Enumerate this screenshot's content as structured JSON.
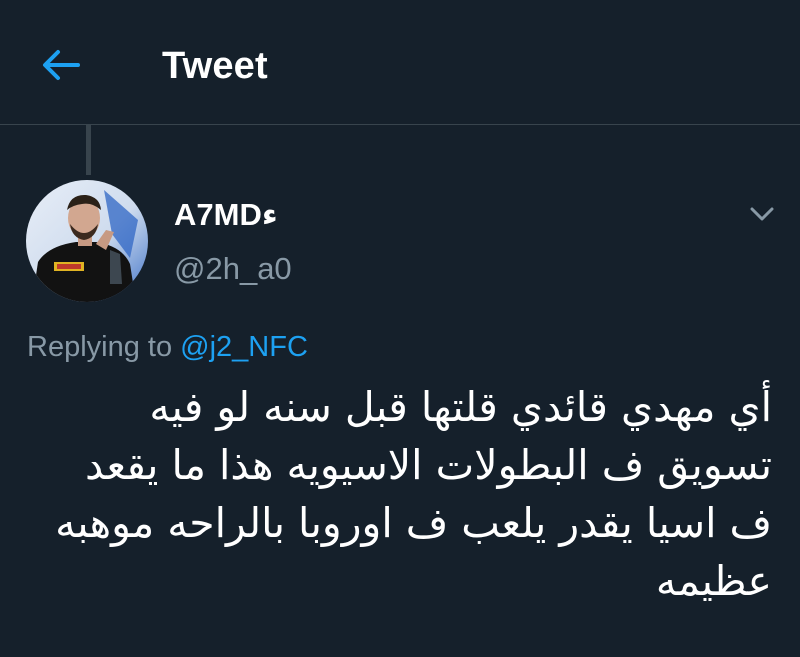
{
  "header": {
    "back_icon": "arrow-left-icon",
    "title": "Tweet"
  },
  "tweet": {
    "author": {
      "display_name": "A7MDء",
      "handle": "@2h_a0",
      "avatar_icon": "user-avatar-photo"
    },
    "menu_icon": "chevron-down-icon",
    "reply": {
      "prefix": "Replying to",
      "mention": "@j2_NFC"
    },
    "text_lines": [
      "أي مهدي قائدي قلتها قبل سنه لو فيه",
      "تسويق ف البطولات الاسيويه هذا ما يقعد",
      "ف اسيا يقدر يلعب ف اوروبا بالراحه موهبه",
      "عظيمه"
    ]
  },
  "colors": {
    "background": "#15202b",
    "accent": "#1da1f2",
    "secondary_text": "#8899a6",
    "divider": "#38444d"
  }
}
